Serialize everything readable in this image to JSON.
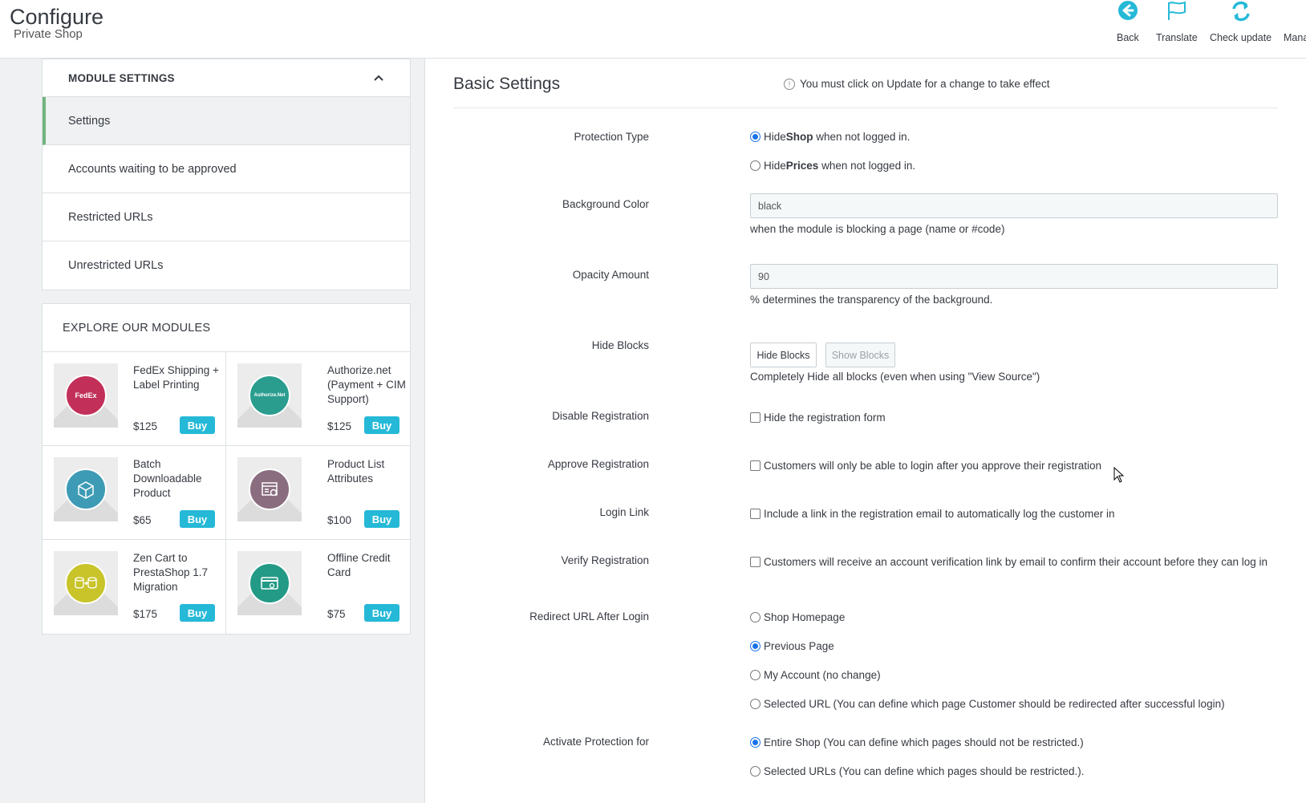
{
  "header": {
    "title": "Configure",
    "subtitle": "Private Shop",
    "toolbar": [
      {
        "label": "Back",
        "icon": "back-arrow-icon"
      },
      {
        "label": "Translate",
        "icon": "flag-icon"
      },
      {
        "label": "Check update",
        "icon": "refresh-icon"
      },
      {
        "label": "Mana",
        "icon": "manage-icon"
      }
    ]
  },
  "sidebar": {
    "heading": "MODULE SETTINGS",
    "items": [
      {
        "label": "Settings",
        "active": true
      },
      {
        "label": "Accounts waiting to be approved"
      },
      {
        "label": "Restricted URLs"
      },
      {
        "label": "Unrestricted URLs"
      }
    ]
  },
  "explore": {
    "heading": "EXPLORE OUR MODULES",
    "buy_label": "Buy",
    "modules": [
      {
        "name": "FedEx Shipping + Label Printing",
        "price": "$125",
        "icon_text": "FedEx",
        "color": "#c2305a"
      },
      {
        "name": "Authorize.net (Payment + CIM Support)",
        "price": "$125",
        "icon_text": "Authorize.Net",
        "color": "#2a9d8f"
      },
      {
        "name": "Batch Downloadable Product",
        "price": "$65",
        "icon_text": "",
        "color": "#3d9bb5"
      },
      {
        "name": "Product List Attributes",
        "price": "$100",
        "icon_text": "",
        "color": "#8a6e80"
      },
      {
        "name": "Zen Cart to PrestaShop 1.7 Migration",
        "price": "$175",
        "icon_text": "",
        "color": "#c8c42a"
      },
      {
        "name": "Offline Credit Card",
        "price": "$75",
        "icon_text": "",
        "color": "#239a86"
      }
    ]
  },
  "main": {
    "title": "Basic Settings",
    "notice": "You must click on Update for a change to take effect",
    "fields": {
      "protection_type": {
        "label": "Protection Type",
        "option1_pre": "Hide ",
        "option1_bold": "Shop",
        "option1_post": " when not logged in.",
        "option2_pre": "Hide ",
        "option2_bold": "Prices",
        "option2_post": " when not logged in."
      },
      "background_color": {
        "label": "Background Color",
        "value": "black",
        "help": "when the module is blocking a page (name or #code)"
      },
      "opacity": {
        "label": "Opacity Amount",
        "value": "90",
        "help": "% determines the transparency of the background."
      },
      "hide_blocks": {
        "label": "Hide Blocks",
        "btn_hide": "Hide Blocks",
        "btn_show": "Show Blocks",
        "help": "Completely Hide all blocks (even when using \"View Source\")"
      },
      "disable_registration": {
        "label": "Disable Registration",
        "text": "Hide the registration form"
      },
      "approve_registration": {
        "label": "Approve Registration",
        "text": "Customers will only be able to login after you approve their registration"
      },
      "login_link": {
        "label": "Login Link",
        "text": "Include a link in the registration email to automatically log the customer in"
      },
      "verify_registration": {
        "label": "Verify Registration",
        "text": "Customers will receive an account verification link by email to confirm their account before they can log in"
      },
      "redirect": {
        "label": "Redirect URL After Login",
        "options": [
          "Shop Homepage",
          "Previous Page",
          "My Account (no change)",
          "Selected URL (You can define which page Customer should be redirected after successful login)"
        ],
        "selected": 1
      },
      "activate": {
        "label": "Activate Protection for",
        "options": [
          "Entire Shop (You can define which pages should not be restricted.)",
          "Selected URLs (You can define which pages should be restricted.)."
        ],
        "selected": 0
      }
    }
  }
}
